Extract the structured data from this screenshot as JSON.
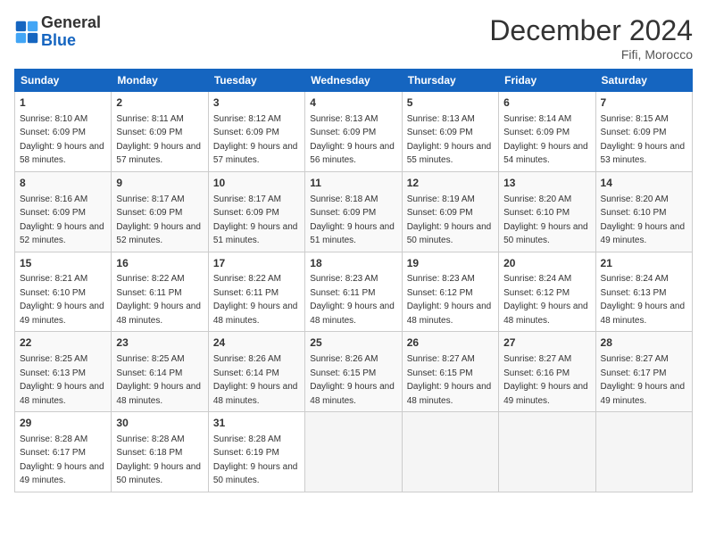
{
  "header": {
    "logo": {
      "general": "General",
      "blue": "Blue"
    },
    "title": "December 2024",
    "location": "Fifi, Morocco"
  },
  "calendar": {
    "weekdays": [
      "Sunday",
      "Monday",
      "Tuesday",
      "Wednesday",
      "Thursday",
      "Friday",
      "Saturday"
    ],
    "weeks": [
      [
        {
          "day": 1,
          "sunrise": "8:10 AM",
          "sunset": "6:09 PM",
          "daylight": "9 hours and 58 minutes."
        },
        {
          "day": 2,
          "sunrise": "8:11 AM",
          "sunset": "6:09 PM",
          "daylight": "9 hours and 57 minutes."
        },
        {
          "day": 3,
          "sunrise": "8:12 AM",
          "sunset": "6:09 PM",
          "daylight": "9 hours and 57 minutes."
        },
        {
          "day": 4,
          "sunrise": "8:13 AM",
          "sunset": "6:09 PM",
          "daylight": "9 hours and 56 minutes."
        },
        {
          "day": 5,
          "sunrise": "8:13 AM",
          "sunset": "6:09 PM",
          "daylight": "9 hours and 55 minutes."
        },
        {
          "day": 6,
          "sunrise": "8:14 AM",
          "sunset": "6:09 PM",
          "daylight": "9 hours and 54 minutes."
        },
        {
          "day": 7,
          "sunrise": "8:15 AM",
          "sunset": "6:09 PM",
          "daylight": "9 hours and 53 minutes."
        }
      ],
      [
        {
          "day": 8,
          "sunrise": "8:16 AM",
          "sunset": "6:09 PM",
          "daylight": "9 hours and 52 minutes."
        },
        {
          "day": 9,
          "sunrise": "8:17 AM",
          "sunset": "6:09 PM",
          "daylight": "9 hours and 52 minutes."
        },
        {
          "day": 10,
          "sunrise": "8:17 AM",
          "sunset": "6:09 PM",
          "daylight": "9 hours and 51 minutes."
        },
        {
          "day": 11,
          "sunrise": "8:18 AM",
          "sunset": "6:09 PM",
          "daylight": "9 hours and 51 minutes."
        },
        {
          "day": 12,
          "sunrise": "8:19 AM",
          "sunset": "6:09 PM",
          "daylight": "9 hours and 50 minutes."
        },
        {
          "day": 13,
          "sunrise": "8:20 AM",
          "sunset": "6:10 PM",
          "daylight": "9 hours and 50 minutes."
        },
        {
          "day": 14,
          "sunrise": "8:20 AM",
          "sunset": "6:10 PM",
          "daylight": "9 hours and 49 minutes."
        }
      ],
      [
        {
          "day": 15,
          "sunrise": "8:21 AM",
          "sunset": "6:10 PM",
          "daylight": "9 hours and 49 minutes."
        },
        {
          "day": 16,
          "sunrise": "8:22 AM",
          "sunset": "6:11 PM",
          "daylight": "9 hours and 48 minutes."
        },
        {
          "day": 17,
          "sunrise": "8:22 AM",
          "sunset": "6:11 PM",
          "daylight": "9 hours and 48 minutes."
        },
        {
          "day": 18,
          "sunrise": "8:23 AM",
          "sunset": "6:11 PM",
          "daylight": "9 hours and 48 minutes."
        },
        {
          "day": 19,
          "sunrise": "8:23 AM",
          "sunset": "6:12 PM",
          "daylight": "9 hours and 48 minutes."
        },
        {
          "day": 20,
          "sunrise": "8:24 AM",
          "sunset": "6:12 PM",
          "daylight": "9 hours and 48 minutes."
        },
        {
          "day": 21,
          "sunrise": "8:24 AM",
          "sunset": "6:13 PM",
          "daylight": "9 hours and 48 minutes."
        }
      ],
      [
        {
          "day": 22,
          "sunrise": "8:25 AM",
          "sunset": "6:13 PM",
          "daylight": "9 hours and 48 minutes."
        },
        {
          "day": 23,
          "sunrise": "8:25 AM",
          "sunset": "6:14 PM",
          "daylight": "9 hours and 48 minutes."
        },
        {
          "day": 24,
          "sunrise": "8:26 AM",
          "sunset": "6:14 PM",
          "daylight": "9 hours and 48 minutes."
        },
        {
          "day": 25,
          "sunrise": "8:26 AM",
          "sunset": "6:15 PM",
          "daylight": "9 hours and 48 minutes."
        },
        {
          "day": 26,
          "sunrise": "8:27 AM",
          "sunset": "6:15 PM",
          "daylight": "9 hours and 48 minutes."
        },
        {
          "day": 27,
          "sunrise": "8:27 AM",
          "sunset": "6:16 PM",
          "daylight": "9 hours and 49 minutes."
        },
        {
          "day": 28,
          "sunrise": "8:27 AM",
          "sunset": "6:17 PM",
          "daylight": "9 hours and 49 minutes."
        }
      ],
      [
        {
          "day": 29,
          "sunrise": "8:28 AM",
          "sunset": "6:17 PM",
          "daylight": "9 hours and 49 minutes."
        },
        {
          "day": 30,
          "sunrise": "8:28 AM",
          "sunset": "6:18 PM",
          "daylight": "9 hours and 50 minutes."
        },
        {
          "day": 31,
          "sunrise": "8:28 AM",
          "sunset": "6:19 PM",
          "daylight": "9 hours and 50 minutes."
        },
        null,
        null,
        null,
        null
      ]
    ]
  }
}
